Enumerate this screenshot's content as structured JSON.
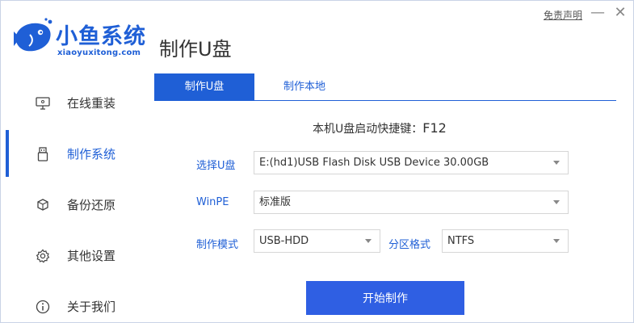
{
  "header": {
    "logo_title": "小鱼系统",
    "logo_domain": "xiaoyuxitong.com",
    "page_title": "制作U盘",
    "disclaimer": "免责声明",
    "minimize_glyph": "—",
    "close_glyph": "✕"
  },
  "sidebar": {
    "items": [
      {
        "label": "在线重装",
        "icon": "monitor-icon"
      },
      {
        "label": "制作系统",
        "icon": "usb-drive-icon",
        "active": true
      },
      {
        "label": "备份还原",
        "icon": "backup-cube-icon"
      },
      {
        "label": "其他设置",
        "icon": "gear-icon"
      },
      {
        "label": "关于我们",
        "icon": "info-icon"
      }
    ]
  },
  "tabs": [
    {
      "label": "制作U盘",
      "active": true
    },
    {
      "label": "制作本地",
      "active": false
    }
  ],
  "hotkey": {
    "label": "本机U盘启动快捷键：",
    "key": "F12"
  },
  "form": {
    "usb": {
      "label": "选择U盘",
      "value": "E:(hd1)USB Flash Disk USB Device 30.00GB"
    },
    "winpe": {
      "label": "WinPE",
      "value": "标准版"
    },
    "mode": {
      "label": "制作模式",
      "value": "USB-HDD"
    },
    "partition": {
      "label": "分区格式",
      "value": "NTFS"
    }
  },
  "start_button": "开始制作",
  "colors": {
    "accent": "#1f5fd6",
    "button": "#2f5fe3",
    "text": "#333333"
  }
}
